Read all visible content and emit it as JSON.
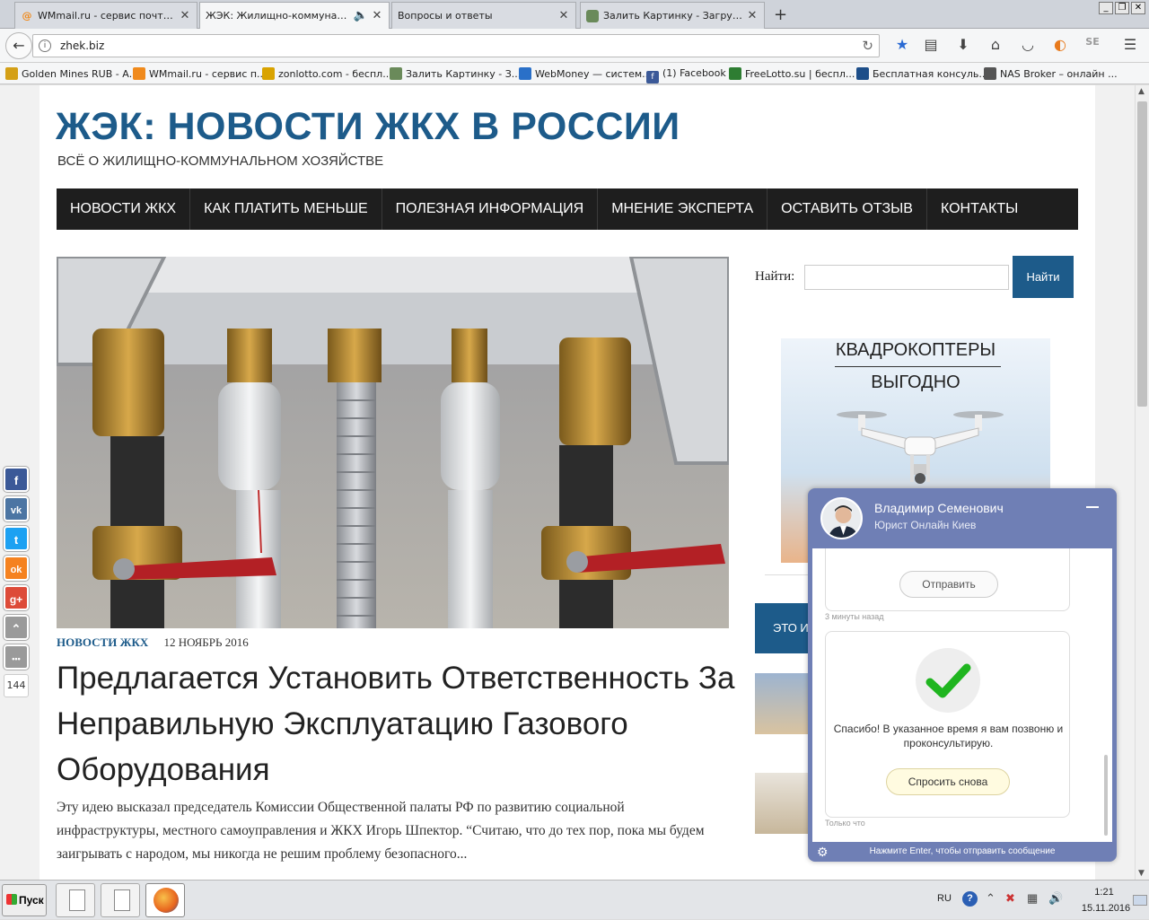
{
  "browser": {
    "tabs": [
      {
        "label": "WMmail.ru - сервис почтовы...",
        "active": false
      },
      {
        "label": "ЖЭК: Жилищно-коммунальн...",
        "active": true
      },
      {
        "label": "Вопросы и ответы",
        "active": false
      },
      {
        "label": "Залить Картинку - Загрузи...",
        "active": false
      }
    ],
    "new_tab": "+",
    "url": "zhek.biz",
    "bookmarks": [
      {
        "label": "Golden Mines RUB - А...",
        "color": "#d4a017"
      },
      {
        "label": "WMmail.ru - сервис п...",
        "color": "#f08a1c"
      },
      {
        "label": "zonlotto.com - беспл...",
        "color": "#d9a300"
      },
      {
        "label": "Залить Картинку - З...",
        "color": "#6a8a5a"
      },
      {
        "label": "WebMoney — систем...",
        "color": "#2a70c8"
      },
      {
        "label": "(1) Facebook",
        "color": "#3b5998"
      },
      {
        "label": "FreeLotto.su | беспл...",
        "color": "#2e7d32"
      },
      {
        "label": "Бесплатная консуль...",
        "color": "#1d4e89"
      },
      {
        "label": "NAS Broker – онлайн ...",
        "color": "#555555"
      }
    ]
  },
  "site": {
    "title": "ЖЭК: НОВОСТИ ЖКХ В РОССИИ",
    "subtitle": "ВСЁ О ЖИЛИЩНО-КОММУНАЛЬНОМ ХОЗЯЙСТВЕ",
    "menu": [
      "НОВОСТИ ЖКХ",
      "КАК ПЛАТИТЬ МЕНЬШЕ",
      "ПОЛЕЗНАЯ ИНФОРМАЦИЯ",
      "МНЕНИЕ ЭКСПЕРТА",
      "ОСТАВИТЬ ОТЗЫВ",
      "КОНТАКТЫ"
    ],
    "accent": "#1d5b8a"
  },
  "article": {
    "category": "НОВОСТИ ЖКХ",
    "date": "12 НОЯБРЬ 2016",
    "headline": "Предлагается Установить Ответственность За Неправильную Эксплуатацию Газового Оборудования",
    "excerpt": "Эту идею высказал председатель Комиссии Общественной палаты РФ по развитию социальной инфраструктуры, местного самоуправления и ЖКХ Игорь Шпектор. “Считаю, что до тех пор, пока мы будем заигрывать с народом, мы никогда не решим проблему безопасного..."
  },
  "sidebar": {
    "search_label": "Найти:",
    "search_button": "Найти",
    "ad_line1": "КВАДРОКОПТЕРЫ",
    "ad_line2": "ВЫГОДНО",
    "box_label": "ЭТО И"
  },
  "social": {
    "buttons": [
      {
        "name": "facebook",
        "glyph": "f",
        "color": "#3b5998"
      },
      {
        "name": "vkontakte",
        "glyph": "vk",
        "color": "#4c75a3"
      },
      {
        "name": "twitter",
        "glyph": "t",
        "color": "#1da1f2"
      },
      {
        "name": "odnoklassniki",
        "glyph": "ok",
        "color": "#f58220"
      },
      {
        "name": "googleplus",
        "glyph": "g+",
        "color": "#dd4b39"
      },
      {
        "name": "scroll-up",
        "glyph": "⌃",
        "color": "#9a9a9a"
      },
      {
        "name": "more",
        "glyph": "•••",
        "color": "#9a9a9a"
      }
    ],
    "count": "144"
  },
  "chat": {
    "agent_name": "Владимир Семенович",
    "agent_role": "Юрист Онлайн Киев",
    "send_button": "Отправить",
    "time_ago": "3 минуты назад",
    "thanks_text": "Спасибо! В указанное время я вам позвоню и проконсультирую.",
    "ask_again": "Спросить снова",
    "just_now": "Только что",
    "footer_hint": "Нажмите Enter, чтобы отправить сообщение",
    "color": "#6f7fb5"
  },
  "taskbar": {
    "start": "Пуск",
    "lang": "RU",
    "time": "1:21",
    "date": "15.11.2016"
  }
}
